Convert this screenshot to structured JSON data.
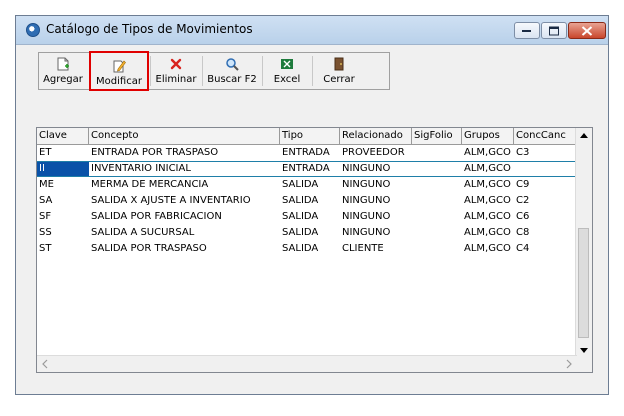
{
  "window": {
    "title": "Catálogo de Tipos de Movimientos"
  },
  "toolbar": {
    "agregar": "Agregar",
    "modificar": "Modificar",
    "eliminar": "Eliminar",
    "buscar": "Buscar F2",
    "excel": "Excel",
    "cerrar": "Cerrar"
  },
  "grid": {
    "columns": [
      "Clave",
      "Concepto",
      "Tipo",
      "Relacionado",
      "SigFolio",
      "Grupos",
      "ConcCanc"
    ],
    "rows": [
      [
        "ET",
        "ENTRADA POR TRASPASO",
        "ENTRADA",
        "PROVEEDOR",
        "",
        "ALM,GCO",
        "C3"
      ],
      [
        "II",
        "INVENTARIO INICIAL",
        "ENTRADA",
        "NINGUNO",
        "",
        "ALM,GCO",
        ""
      ],
      [
        "ME",
        "MERMA DE MERCANCIA",
        "SALIDA",
        "NINGUNO",
        "",
        "ALM,GCO",
        "C9"
      ],
      [
        "SA",
        "SALIDA X AJUSTE A INVENTARIO",
        "SALIDA",
        "NINGUNO",
        "",
        "ALM,GCO",
        "C2"
      ],
      [
        "SF",
        "SALIDA POR FABRICACION",
        "SALIDA",
        "NINGUNO",
        "",
        "ALM,GCO",
        "C6"
      ],
      [
        "SS",
        "SALIDA A SUCURSAL",
        "SALIDA",
        "NINGUNO",
        "",
        "ALM,GCO",
        "C8"
      ],
      [
        "ST",
        "SALIDA POR TRASPASO",
        "SALIDA",
        "CLIENTE",
        "",
        "ALM,GCO",
        "C4"
      ]
    ],
    "selected_row": 1
  },
  "colors": {
    "highlight_border": "#e00000",
    "selection": "#0a52a8"
  }
}
